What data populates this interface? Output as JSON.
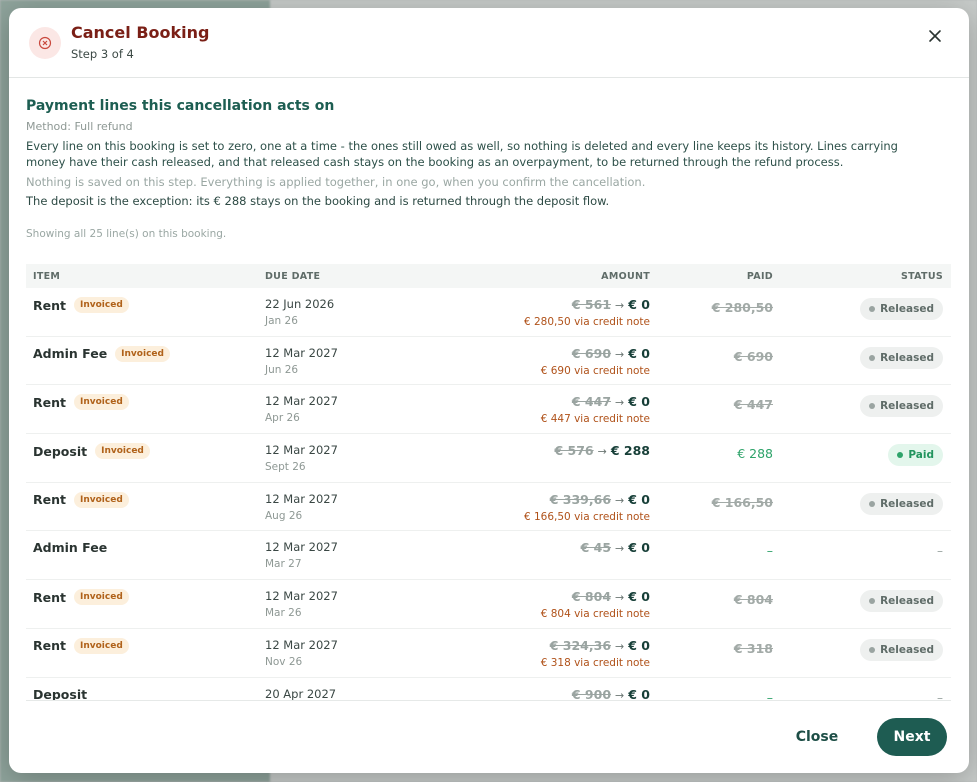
{
  "header": {
    "title": "Cancel Booking",
    "subtitle": "Step 3 of 4"
  },
  "section": {
    "title": "Payment lines this cancellation acts on",
    "method": "Method: Full refund",
    "paragraph": "Every line on this booking is set to zero, one at a time - the ones still owed as well, so nothing is deleted and every line keeps its history. Lines carrying money have their cash released, and that released cash stays on the booking as an overpayment, to be returned through the refund process.",
    "note": "Nothing is saved on this step. Everything is applied together, in one go, when you confirm the cancellation.",
    "deposit_note": "The deposit is the exception: its € 288 stays on the booking and is returned through the deposit flow.",
    "showing": "Showing all 25 line(s) on this booking."
  },
  "table": {
    "headers": {
      "item": "ITEM",
      "due": "DUE DATE",
      "amount": "AMOUNT",
      "paid": "PAID",
      "status": "STATUS"
    },
    "badge_label": "Invoiced",
    "rows": [
      {
        "item": "Rent",
        "invoiced": true,
        "due": "22 Jun 2026",
        "period": "Jan 26",
        "old": "€ 561",
        "new": "€ 0",
        "credit": "€ 280,50 via credit note",
        "paid": "€ 280,50",
        "paid_style": "strike",
        "status": "Released"
      },
      {
        "item": "Admin Fee",
        "invoiced": true,
        "due": "12 Mar 2027",
        "period": "Jun 26",
        "old": "€ 690",
        "new": "€ 0",
        "credit": "€ 690 via credit note",
        "paid": "€ 690",
        "paid_style": "strike",
        "status": "Released"
      },
      {
        "item": "Rent",
        "invoiced": true,
        "due": "12 Mar 2027",
        "period": "Apr 26",
        "old": "€ 447",
        "new": "€ 0",
        "credit": "€ 447 via credit note",
        "paid": "€ 447",
        "paid_style": "strike",
        "status": "Released"
      },
      {
        "item": "Deposit",
        "invoiced": true,
        "due": "12 Mar 2027",
        "period": "Sept 26",
        "old": "€ 576",
        "new": "€ 288",
        "credit": "",
        "paid": "€ 288",
        "paid_style": "green",
        "status": "Paid"
      },
      {
        "item": "Rent",
        "invoiced": true,
        "due": "12 Mar 2027",
        "period": "Aug 26",
        "old": "€ 339,66",
        "new": "€ 0",
        "credit": "€ 166,50 via credit note",
        "paid": "€ 166,50",
        "paid_style": "strike",
        "status": "Released"
      },
      {
        "item": "Admin Fee",
        "invoiced": false,
        "due": "12 Mar 2027",
        "period": "Mar 27",
        "old": "€ 45",
        "new": "€ 0",
        "credit": "",
        "paid": "–",
        "paid_style": "dash",
        "status": "–"
      },
      {
        "item": "Rent",
        "invoiced": true,
        "due": "12 Mar 2027",
        "period": "Mar 26",
        "old": "€ 804",
        "new": "€ 0",
        "credit": "€ 804 via credit note",
        "paid": "€ 804",
        "paid_style": "strike",
        "status": "Released"
      },
      {
        "item": "Rent",
        "invoiced": true,
        "due": "12 Mar 2027",
        "period": "Nov 26",
        "old": "€ 324,36",
        "new": "€ 0",
        "credit": "€ 318 via credit note",
        "paid": "€ 318",
        "paid_style": "strike",
        "status": "Released"
      },
      {
        "item": "Deposit",
        "invoiced": false,
        "due": "20 Apr 2027",
        "period": "",
        "old": "€ 900",
        "new": "€ 0",
        "credit": "",
        "paid": "–",
        "paid_style": "dash",
        "status": "–"
      }
    ]
  },
  "footer": {
    "close_label": "Close",
    "next_label": "Next"
  },
  "colors": {
    "accent": "#1e5c52",
    "danger": "#7a1f16",
    "credit": "#b0521a",
    "paid_green": "#2ea36a"
  },
  "icons": {
    "header": "cancel-circle-icon",
    "close": "close-icon",
    "arrow": "arrow-right-icon"
  }
}
